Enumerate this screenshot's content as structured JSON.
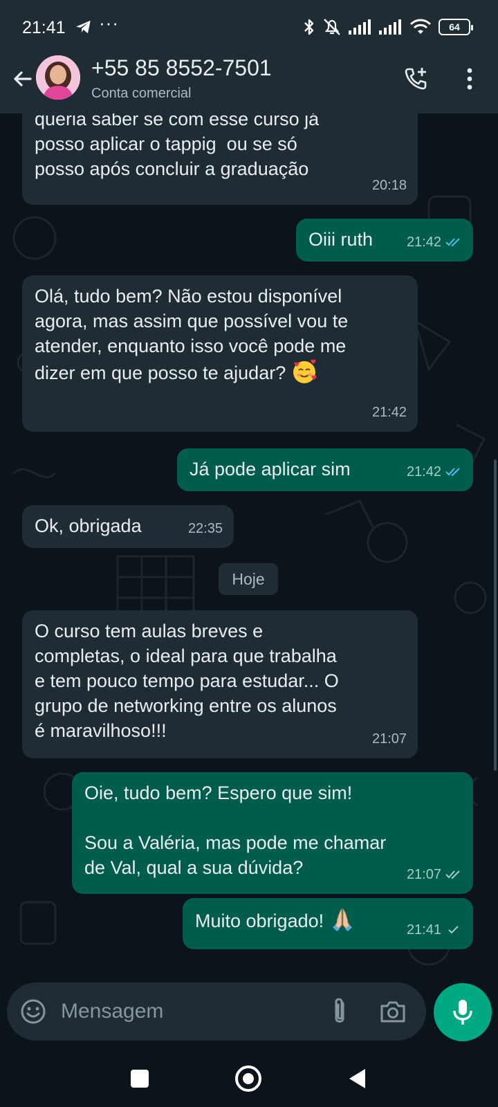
{
  "status_bar": {
    "time": "21:41",
    "dots": "···",
    "battery": "64"
  },
  "header": {
    "contact_name": "+55 85 8552-7501",
    "subtitle": "Conta comercial"
  },
  "messages": [
    {
      "direction": "in",
      "text": "posso aplicar o tappig  ou se só\nposso após concluir a graduação",
      "time": "20:18",
      "partial_top": "queria saber se com esse curso já"
    },
    {
      "direction": "out",
      "text": "Oiii ruth",
      "time": "21:42",
      "status": "read"
    },
    {
      "direction": "in",
      "text": "Olá, tudo bem? Não estou disponível\nagora, mas assim que possível vou te\natender, enquanto isso você pode me\ndizer em que posso te ajudar?",
      "emoji": "smiling-face-with-hearts",
      "time": "21:42"
    },
    {
      "direction": "out",
      "text": "Já pode aplicar sim",
      "time": "21:42",
      "status": "read"
    },
    {
      "direction": "in",
      "text": "Ok, obrigada",
      "time": "22:35"
    },
    {
      "direction": "in",
      "text": "O curso tem aulas breves e\ncompletas, o ideal para que trabalha\ne tem pouco tempo para estudar... O\ngrupo de networking entre os alunos\né maravilhoso!!!",
      "time": "21:07"
    },
    {
      "direction": "out",
      "text": "Oie, tudo bem? Espero que sim!\n\nSou a Valéria, mas pode me chamar\nde Val, qual a sua dúvida?",
      "time": "21:07",
      "status": "delivered"
    },
    {
      "direction": "out",
      "text": "Muito obrigado!",
      "emoji": "folded-hands",
      "time": "21:41",
      "status": "sent"
    }
  ],
  "day_separator": "Hoje",
  "composer": {
    "placeholder": "Mensagem"
  },
  "colors": {
    "background": "#0b141a",
    "header": "#1f2c34",
    "incoming_bubble": "#1f2c34",
    "outgoing_bubble": "#005c4b",
    "accent": "#00a884",
    "read_tick": "#53bdeb"
  },
  "icons": [
    "telegram-icon",
    "bluetooth-icon",
    "mute-icon",
    "signal-icon",
    "wifi-icon",
    "battery-icon",
    "back-arrow-icon",
    "add-call-icon",
    "more-vert-icon",
    "emoji-icon",
    "attach-icon",
    "camera-icon",
    "mic-icon"
  ]
}
